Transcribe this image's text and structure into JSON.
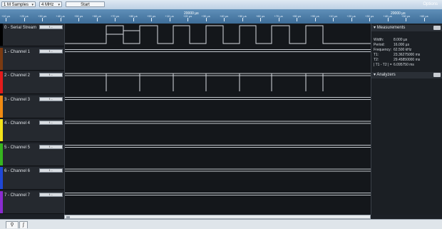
{
  "toolbar": {
    "samples": "1 M Samples",
    "rate": "4 MHz",
    "start": "Start",
    "options": "Options"
  },
  "ruler": {
    "major_labels": [
      "20000 µs",
      "20000 µs"
    ],
    "tick_labels": [
      "+10 µs",
      "+20 µs",
      "+30 µs",
      "+40 µs",
      "+50 µs",
      "+60 µs",
      "+70 µs",
      "+80 µs",
      "+90 µs",
      "+10 µs",
      "+20 µs",
      "+30 µs",
      "+40 µs",
      "+50 µs",
      "+60 µs",
      "+70 µs",
      "+80 µs",
      "+90 µs",
      "+10 µs",
      "+20 µs",
      "+30 µs",
      "+40 µs",
      "+50 µs",
      "+60 µs"
    ]
  },
  "channels": [
    {
      "label": "0 - Serial Stream",
      "color": "#000000"
    },
    {
      "label": "1 - Channel 1",
      "color": "#7a3b12"
    },
    {
      "label": "2 - Channel 2",
      "color": "#e31b1b"
    },
    {
      "label": "3 - Channel 3",
      "color": "#f08a12"
    },
    {
      "label": "4 - Channel 4",
      "color": "#f2e21a"
    },
    {
      "label": "5 - Channel 5",
      "color": "#37b51f"
    },
    {
      "label": "6 - Channel 6",
      "color": "#1f47d6"
    },
    {
      "label": "7 - Channel 7",
      "color": "#8a2bd0"
    }
  ],
  "channel_control_text": "f ...",
  "measurements": {
    "title": "Measurements",
    "rows": [
      {
        "label": "Width:",
        "value": "8.000 µs"
      },
      {
        "label": "Period:",
        "value": "16.000 µs"
      },
      {
        "label": "Frequency:",
        "value": "62.500 kHz"
      },
      {
        "label": "T1:",
        "value": "23.36275000 ms"
      },
      {
        "label": "T2:",
        "value": "29.45850000 ms"
      },
      {
        "label": "| T1 - T2 | =",
        "value": "6.095750 ms"
      }
    ]
  },
  "analyzers": {
    "title": "Analyzers"
  },
  "tabs": {
    "search_icon": "search-icon",
    "measure_icon": "pulse-icon"
  }
}
